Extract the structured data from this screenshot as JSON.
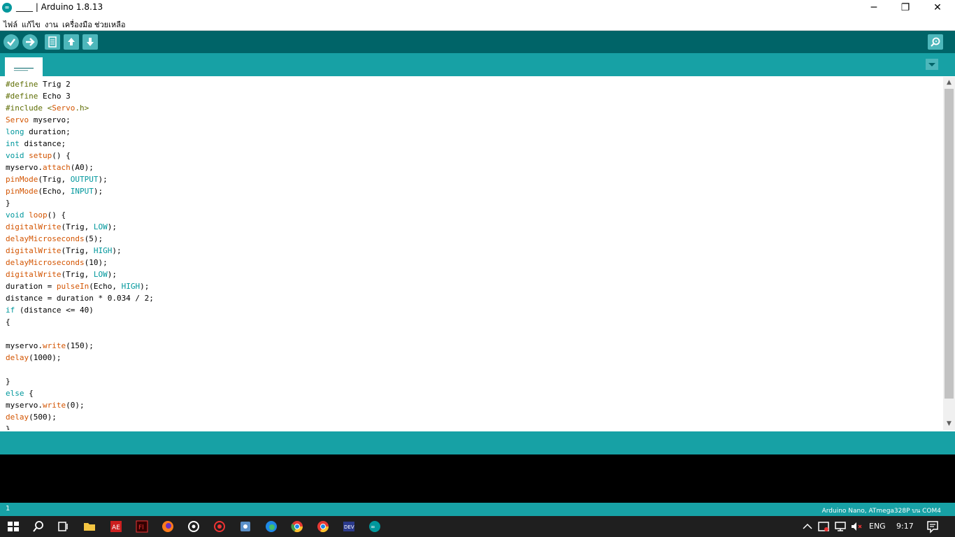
{
  "window": {
    "title": "____ | Arduino 1.8.13",
    "logo": "∞",
    "minimize": "─",
    "maximize": "❐",
    "close": "✕"
  },
  "menu": [
    "ไฟล์",
    "แก้ไข",
    "งาน",
    "เครื่องมือ",
    "ช่วยเหลือ"
  ],
  "toolbar": {
    "icons": [
      "verify-icon",
      "upload-icon",
      "new-icon",
      "open-icon",
      "save-icon",
      "serial-monitor-icon"
    ]
  },
  "tabs": [
    {
      "label": "____"
    }
  ],
  "editor": {
    "lines": [
      [
        [
          "#define",
          "d"
        ],
        [
          " Trig 2",
          "n"
        ]
      ],
      [
        [
          "#define",
          "d"
        ],
        [
          " Echo 3",
          "n"
        ]
      ],
      [
        [
          "#include",
          "d"
        ],
        [
          " <",
          "d"
        ],
        [
          "Servo",
          "k"
        ],
        [
          ".h>",
          "d"
        ]
      ],
      [
        [
          "Servo",
          "k"
        ],
        [
          " myservo;",
          "n"
        ]
      ],
      [
        [
          "long",
          "t"
        ],
        [
          " duration;",
          "n"
        ]
      ],
      [
        [
          "int",
          "t"
        ],
        [
          " distance;",
          "n"
        ]
      ],
      [
        [
          "void",
          "t"
        ],
        [
          " ",
          "n"
        ],
        [
          "setup",
          "f"
        ],
        [
          "() {",
          "n"
        ]
      ],
      [
        [
          "myservo.",
          "n"
        ],
        [
          "attach",
          "f"
        ],
        [
          "(A0);",
          "n"
        ]
      ],
      [
        [
          "pinMode",
          "f"
        ],
        [
          "(Trig, ",
          "n"
        ],
        [
          "OUTPUT",
          "c"
        ],
        [
          ");",
          "n"
        ]
      ],
      [
        [
          "pinMode",
          "f"
        ],
        [
          "(Echo, ",
          "n"
        ],
        [
          "INPUT",
          "c"
        ],
        [
          ");",
          "n"
        ]
      ],
      [
        [
          "}",
          "n"
        ]
      ],
      [
        [
          "void",
          "t"
        ],
        [
          " ",
          "n"
        ],
        [
          "loop",
          "f"
        ],
        [
          "() {",
          "n"
        ]
      ],
      [
        [
          "digitalWrite",
          "f"
        ],
        [
          "(Trig, ",
          "n"
        ],
        [
          "LOW",
          "c"
        ],
        [
          ");",
          "n"
        ]
      ],
      [
        [
          "delayMicroseconds",
          "f"
        ],
        [
          "(5);",
          "n"
        ]
      ],
      [
        [
          "digitalWrite",
          "f"
        ],
        [
          "(Trig, ",
          "n"
        ],
        [
          "HIGH",
          "c"
        ],
        [
          ");",
          "n"
        ]
      ],
      [
        [
          "delayMicroseconds",
          "f"
        ],
        [
          "(10);",
          "n"
        ]
      ],
      [
        [
          "digitalWrite",
          "f"
        ],
        [
          "(Trig, ",
          "n"
        ],
        [
          "LOW",
          "c"
        ],
        [
          ");",
          "n"
        ]
      ],
      [
        [
          "duration = ",
          "n"
        ],
        [
          "pulseIn",
          "f"
        ],
        [
          "(Echo, ",
          "n"
        ],
        [
          "HIGH",
          "c"
        ],
        [
          ");",
          "n"
        ]
      ],
      [
        [
          "distance = duration * 0.034 / 2;",
          "n"
        ]
      ],
      [
        [
          "if",
          "t"
        ],
        [
          " (distance <= 40)",
          "n"
        ]
      ],
      [
        [
          "{",
          "n"
        ]
      ],
      [
        [
          "",
          "n"
        ]
      ],
      [
        [
          "myservo.",
          "n"
        ],
        [
          "write",
          "f"
        ],
        [
          "(150);",
          "n"
        ]
      ],
      [
        [
          "delay",
          "f"
        ],
        [
          "(1000);",
          "n"
        ]
      ],
      [
        [
          "",
          "n"
        ]
      ],
      [
        [
          "}",
          "n"
        ]
      ],
      [
        [
          "else",
          "t"
        ],
        [
          " {",
          "n"
        ]
      ],
      [
        [
          "myservo.",
          "n"
        ],
        [
          "write",
          "f"
        ],
        [
          "(0);",
          "n"
        ]
      ],
      [
        [
          "delay",
          "f"
        ],
        [
          "(500);",
          "n"
        ]
      ],
      [
        [
          "}",
          "n"
        ]
      ]
    ]
  },
  "colors": {
    "d": "#5e6d03",
    "k": "#d35400",
    "t": "#00979c",
    "f": "#d35400",
    "c": "#00979c",
    "n": "#000000"
  },
  "status": {
    "line": "1",
    "board": "Arduino Nano, ATmega328P บน COM4"
  },
  "taskbar": {
    "lang": "ENG",
    "time": "9:17"
  }
}
